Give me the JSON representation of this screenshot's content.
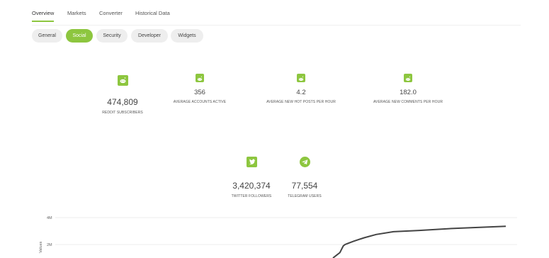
{
  "top_tabs": [
    "Overview",
    "Markets",
    "Converter",
    "Historical Data"
  ],
  "pills": [
    "General",
    "Social",
    "Security",
    "Developer",
    "Widgets"
  ],
  "reddit": [
    {
      "value": "474,809",
      "label": "REDDIT SUBSCRIBERS",
      "icon": "reddit-icon"
    },
    {
      "value": "356",
      "label": "AVERAGE ACCOUNTS ACTIVE",
      "icon": "reddit-icon"
    },
    {
      "value": "4.2",
      "label": "AVERAGE NEW HOT POSTS PER HOUR",
      "icon": "reddit-icon"
    },
    {
      "value": "182.0",
      "label": "AVERAGE NEW COMMENTS PER HOUR",
      "icon": "reddit-icon"
    }
  ],
  "social": [
    {
      "value": "3,420,374",
      "label": "TWITTER FOLLOWERS",
      "icon": "twitter-icon"
    },
    {
      "value": "77,554",
      "label": "TELEGRAM USERS",
      "icon": "telegram-icon"
    }
  ],
  "colors": {
    "accent": "#8dc63f",
    "line": "#444444"
  },
  "chart_data": {
    "type": "line",
    "ylabel": "Values",
    "yticks": [
      "4M",
      "2M"
    ],
    "ylim_visible": [
      1300000,
      4500000
    ],
    "series": [
      {
        "values": [
          [
            0.0,
            1.0
          ],
          [
            0.02,
            1.2
          ],
          [
            0.04,
            1.4
          ],
          [
            0.06,
            1.9
          ],
          [
            0.07,
            2.0
          ],
          [
            0.09,
            2.1
          ],
          [
            0.12,
            2.25
          ],
          [
            0.18,
            2.5
          ],
          [
            0.25,
            2.75
          ],
          [
            0.35,
            2.95
          ],
          [
            0.5,
            3.05
          ],
          [
            0.7,
            3.2
          ],
          [
            1.0,
            3.35
          ]
        ]
      }
    ]
  }
}
